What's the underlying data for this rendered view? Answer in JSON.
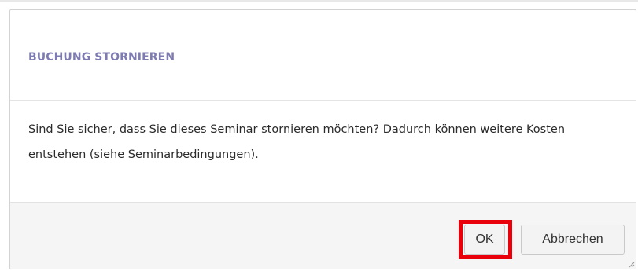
{
  "dialog": {
    "title": "BUCHUNG STORNIEREN",
    "message": "Sind Sie sicher, dass Sie dieses Seminar stornieren möchten? Dadurch können weitere Kosten entstehen (siehe Seminarbedingungen).",
    "buttons": {
      "ok_label": "OK",
      "cancel_label": "Abbrechen"
    }
  },
  "colors": {
    "title": "#7e7bb2",
    "highlight": "#e8000b",
    "footer_bg": "#f5f5f5"
  },
  "icons": {
    "resize_grip": "resize-grip-icon"
  }
}
